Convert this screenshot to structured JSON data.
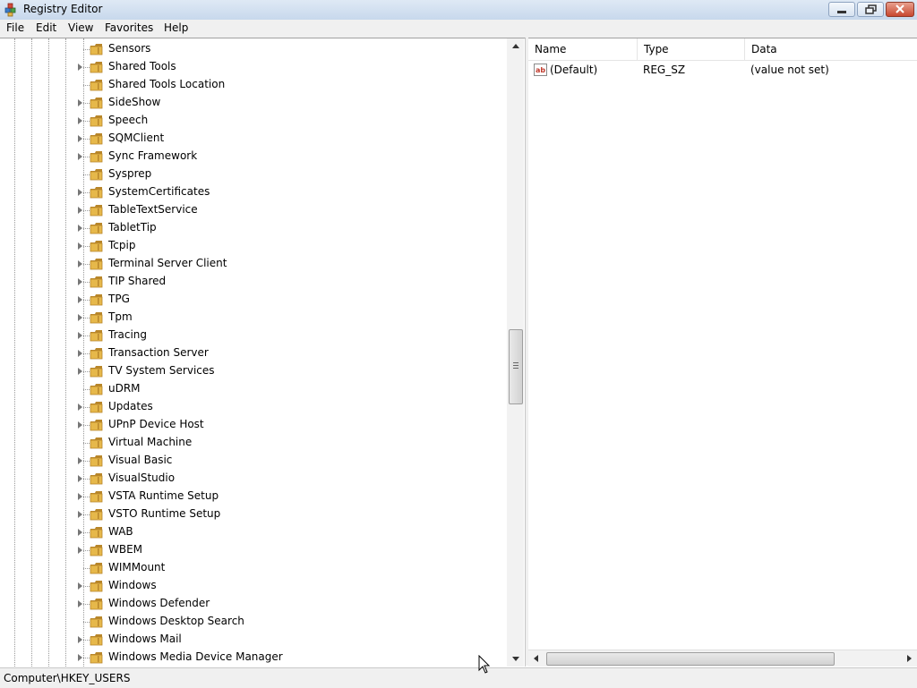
{
  "window": {
    "title": "Registry Editor"
  },
  "menu": [
    "File",
    "Edit",
    "View",
    "Favorites",
    "Help"
  ],
  "tree": {
    "items": [
      {
        "label": "Sensors",
        "expandable": false
      },
      {
        "label": "Shared Tools",
        "expandable": true
      },
      {
        "label": "Shared Tools Location",
        "expandable": false
      },
      {
        "label": "SideShow",
        "expandable": true
      },
      {
        "label": "Speech",
        "expandable": true
      },
      {
        "label": "SQMClient",
        "expandable": true
      },
      {
        "label": "Sync Framework",
        "expandable": true
      },
      {
        "label": "Sysprep",
        "expandable": false
      },
      {
        "label": "SystemCertificates",
        "expandable": true
      },
      {
        "label": "TableTextService",
        "expandable": true
      },
      {
        "label": "TabletTip",
        "expandable": true
      },
      {
        "label": "Tcpip",
        "expandable": true
      },
      {
        "label": "Terminal Server Client",
        "expandable": true
      },
      {
        "label": "TIP Shared",
        "expandable": true
      },
      {
        "label": "TPG",
        "expandable": true
      },
      {
        "label": "Tpm",
        "expandable": true
      },
      {
        "label": "Tracing",
        "expandable": true
      },
      {
        "label": "Transaction Server",
        "expandable": true
      },
      {
        "label": "TV System Services",
        "expandable": true
      },
      {
        "label": "uDRM",
        "expandable": false
      },
      {
        "label": "Updates",
        "expandable": true
      },
      {
        "label": "UPnP Device Host",
        "expandable": true
      },
      {
        "label": "Virtual Machine",
        "expandable": false
      },
      {
        "label": "Visual Basic",
        "expandable": true
      },
      {
        "label": "VisualStudio",
        "expandable": true
      },
      {
        "label": "VSTA Runtime Setup",
        "expandable": true
      },
      {
        "label": "VSTO Runtime Setup",
        "expandable": true
      },
      {
        "label": "WAB",
        "expandable": true
      },
      {
        "label": "WBEM",
        "expandable": true
      },
      {
        "label": "WIMMount",
        "expandable": false
      },
      {
        "label": "Windows",
        "expandable": true
      },
      {
        "label": "Windows Defender",
        "expandable": true
      },
      {
        "label": "Windows Desktop Search",
        "expandable": false
      },
      {
        "label": "Windows Mail",
        "expandable": true
      },
      {
        "label": "Windows Media Device Manager",
        "expandable": true
      }
    ]
  },
  "values": {
    "columns": [
      "Name",
      "Type",
      "Data"
    ],
    "rows": [
      {
        "name": "(Default)",
        "type": "REG_SZ",
        "data": "(value not set)",
        "icon": "string-value-icon"
      }
    ]
  },
  "status": {
    "path": "Computer\\HKEY_USERS"
  },
  "colors": {
    "folder": "#e6b84a",
    "folder_dark": "#b8862a",
    "titlebar": "#c7d8ec",
    "close_button": "#c8472f"
  }
}
